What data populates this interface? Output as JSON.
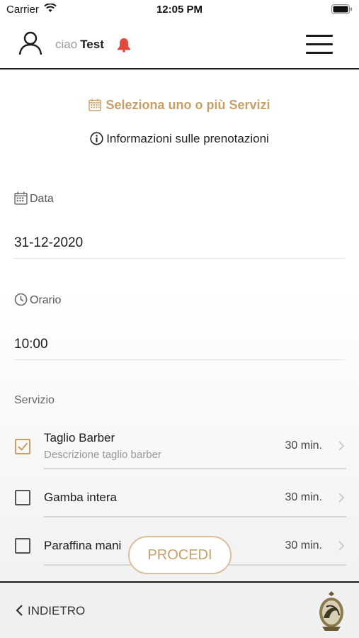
{
  "status_bar": {
    "carrier": "Carrier",
    "time": "12:05 PM"
  },
  "header": {
    "greeting": "ciao",
    "username": "Test"
  },
  "title": "Seleziona uno o più Servizi",
  "info_link": "Informazioni sulle prenotazioni",
  "date": {
    "label": "Data",
    "value": "31-12-2020"
  },
  "time": {
    "label": "Orario",
    "value": "10:00"
  },
  "services_label": "Servizio",
  "services": [
    {
      "name": "Taglio Barber",
      "description": "Descrizione taglio barber",
      "duration": "30 min.",
      "checked": true
    },
    {
      "name": "Gamba intera",
      "description": "",
      "duration": "30 min.",
      "checked": false
    },
    {
      "name": "Paraffina mani",
      "description": "",
      "duration": "30 min.",
      "checked": false
    }
  ],
  "proceed_label": "PROCEDI",
  "back_label": "INDIETRO",
  "colors": {
    "accent": "#c5a06a",
    "bell": "#e04a3f",
    "text": "#1c1c1c"
  }
}
